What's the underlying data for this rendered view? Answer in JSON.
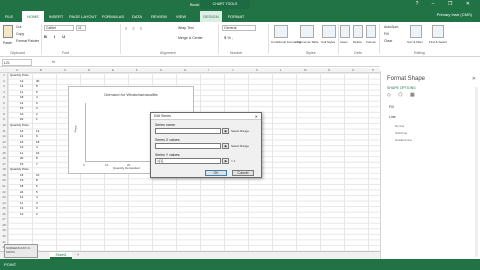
{
  "titlebar": {
    "doc_title": "Book1 - Excel",
    "chart_tools": "CHART TOOLS",
    "window_controls": "? – ❐ ✕",
    "user": "Primary Instr (CMS)"
  },
  "tabs": {
    "file": "FILE",
    "home": "HOME",
    "insert": "INSERT",
    "page_layout": "PAGE LAYOUT",
    "formulas": "FORMULAS",
    "data": "DATA",
    "review": "REVIEW",
    "view": "VIEW",
    "design": "DESIGN",
    "format": "FORMAT"
  },
  "ribbon": {
    "cut": "Cut",
    "copy": "Copy",
    "format_painter": "Format Painter",
    "paste": "Paste",
    "font_name": "Calibri",
    "font_size": "11",
    "font_format": "B I U",
    "wrap_text": "Wrap Text",
    "merge_center": "Merge & Center",
    "number_format": "General",
    "number_symbols": "$ % ,",
    "conditional_formatting": "Conditional Formatting",
    "format_as_table": "Format as Table",
    "cell_styles": "Cell Styles",
    "insert": "Insert",
    "delete": "Delete",
    "format": "Format",
    "autosum": "AutoSum",
    "fill": "Fill",
    "clear": "Clear",
    "sort_filter": "Sort & Filter",
    "find_select": "Find & Select",
    "groups": {
      "clipboard": "Clipboard",
      "font": "Font",
      "alignment": "Alignment",
      "number": "Number",
      "styles": "Styles",
      "cells": "Cells",
      "editing": "Editing"
    }
  },
  "formula_bar": {
    "name_box": "L21",
    "fx": "fx"
  },
  "columns": [
    "A",
    "B",
    "C",
    "D",
    "E",
    "F",
    "G",
    "H",
    "I",
    "J",
    "K",
    "L",
    "M",
    "N",
    "O",
    "P"
  ],
  "rows": [
    "1",
    "2",
    "3",
    "4",
    "5",
    "6",
    "7",
    "8",
    "9",
    "10",
    "11",
    "12",
    "13",
    "14",
    "15",
    "16",
    "17",
    "18",
    "19",
    "20",
    "21",
    "22",
    "23",
    "24",
    "25",
    "26",
    "27",
    "28",
    "29",
    "30",
    "31",
    "32"
  ],
  "cells": {
    "a1": "Quantity Price",
    "b2": "12",
    "c2": "30",
    "b3": "13",
    "c3": "8",
    "b4": "11",
    "c4": "5",
    "b5": "18",
    "c5": "4",
    "b6": "14",
    "c6": "6",
    "b7": "15",
    "c7": "3",
    "b8": "10",
    "c8": "2",
    "b9": "22",
    "c9": "1",
    "a10": "Quantity Price",
    "b11": "16",
    "c11": "12",
    "b12": "14",
    "c12": "9",
    "b13": "15",
    "c13": "18",
    "b14": "13",
    "c14": "4",
    "b15": "11",
    "c15": "16",
    "b16": "20",
    "c16": "8",
    "b17": "15",
    "c17": "7",
    "a18": "Quantity Price",
    "b19": "16",
    "c19": "10",
    "b20": "13",
    "c20": "8",
    "b21": "18",
    "c21": "6",
    "b22": "24",
    "c22": "5",
    "b23": "14",
    "c23": "4",
    "b24": "11",
    "c24": "3",
    "b25": "13",
    "c25": "3",
    "b26": "12",
    "c26": "2"
  },
  "chart": {
    "title": "Demand for Whatchamacallits",
    "ylabel": "Price",
    "xlabel": "Quantity Demanded",
    "ticks": [
      "0",
      "10",
      "20"
    ]
  },
  "dialog": {
    "title": "Edit Series",
    "close": "✕",
    "series_name_label": "Series name:",
    "series_name_value": "",
    "series_name_hint": "Select Range",
    "x_values_label": "Series X values:",
    "x_values_value": "",
    "x_values_hint": "Select Range",
    "y_values_label": "Series Y values:",
    "y_values_value": "={1}",
    "y_values_hint": "= 1",
    "ok": "OK",
    "cancel": "Cancel"
  },
  "sheets": {
    "tab1": "Sheet1",
    "add": "+"
  },
  "statusbar": {
    "text": "POINT"
  },
  "watermark": "SCREENCAST-O-MATIC",
  "pane": {
    "title": "Format Shape",
    "close": "✕",
    "subtitle": "SHAPE OPTIONS",
    "icons": "◇ ⬠ ▦",
    "fill": "Fill",
    "line": "Line",
    "opt1": "No line",
    "opt2": "Solid line",
    "opt3": "Gradient line"
  }
}
